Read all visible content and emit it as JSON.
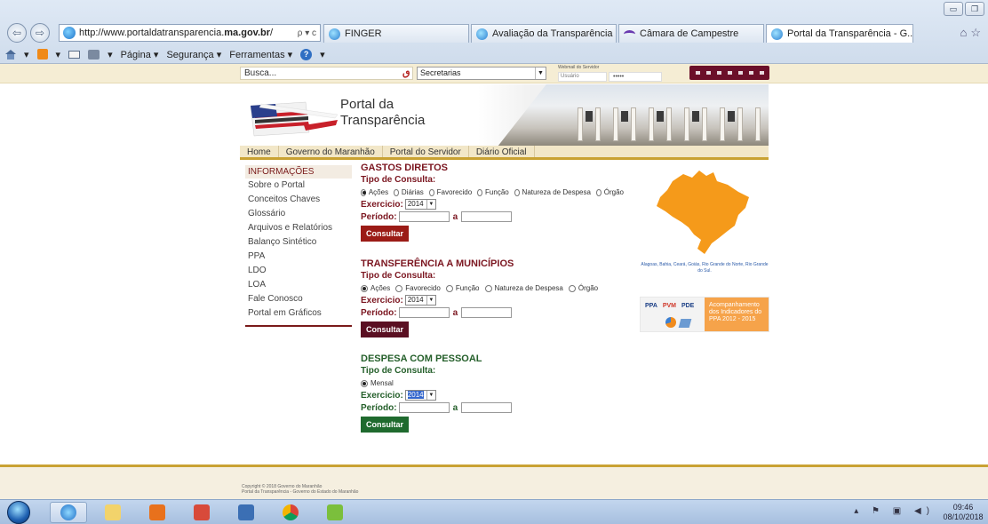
{
  "browser": {
    "url_prefix": "http://www.portaldatransparencia.",
    "url_domain": "ma.gov.br",
    "url_suffix": "/",
    "address_icons": "ρ ▾ c",
    "tabs": [
      {
        "label": "FINGER"
      },
      {
        "label": "Avaliação da Transparência do..."
      },
      {
        "label": "Câmara de Campestre"
      },
      {
        "label": "Portal da Transparência - G..."
      }
    ],
    "command_bar": {
      "page": "Página ▾",
      "security": "Segurança ▾",
      "tools": "Ferramentas ▾"
    }
  },
  "topbar": {
    "search_placeholder": "Busca...",
    "secretarias": "Secretarias",
    "webmail_title": "Webmail do Servidor",
    "webmail_user": "Usuário",
    "webmail_pass": "•••••"
  },
  "header": {
    "title_line1": "Portal da",
    "title_line2": "Transparência"
  },
  "nav": [
    "Home",
    "Governo do Maranhão",
    "Portal do Servidor",
    "Diário Oficial"
  ],
  "sidebar": {
    "heading": "INFORMAÇÕES",
    "items": [
      "Sobre o Portal",
      "Conceitos Chaves",
      "Glossário",
      "Arquivos e Relatórios",
      "Balanço Sintético",
      "PPA",
      "LDO",
      "LOA",
      "Fale Conosco",
      "Portal em Gráficos"
    ]
  },
  "gastos": {
    "title": "GASTOS DIRETOS",
    "tipo": "Tipo de Consulta:",
    "options": [
      "Ações",
      "Diárias",
      "Favorecido",
      "Função",
      "Natureza de Despesa",
      "Órgão"
    ],
    "exercicio_label": "Exercicio:",
    "exercicio_value": "2014",
    "periodo_label": "Período:",
    "a_label": "a",
    "button": "Consultar"
  },
  "transferencia": {
    "title": "TRANSFERÊNCIA A MUNICÍPIOS",
    "tipo": "Tipo de Consulta:",
    "options": [
      "Ações",
      "Favorecido",
      "Função",
      "Natureza de Despesa",
      "Órgão"
    ],
    "exercicio_label": "Exercicio:",
    "exercicio_value": "2014",
    "periodo_label": "Período:",
    "a_label": "a",
    "button": "Consultar"
  },
  "despesa": {
    "title": "DESPESA COM PESSOAL",
    "tipo": "Tipo de Consulta:",
    "options": [
      "Mensal"
    ],
    "exercicio_label": "Exercicio:",
    "exercicio_value": "2014",
    "periodo_label": "Período:",
    "a_label": "a",
    "button": "Consultar"
  },
  "map_caption": "Alagoas, Bahia, Ceará, Goiás, Rio Grande do Norte, Rio Grande do Sul.",
  "ppa_banner": {
    "ppa": "PPA",
    "pvm": "PVM",
    "pde": "PDE",
    "right_line1": "Acompanhamento",
    "right_line2": "dos Indicadores do",
    "right_line3": "PPA 2012 - 2015"
  },
  "footer": {
    "copyright_line1": "Copyright © 2018 Governo do Maranhão",
    "copyright_line2": "Portal da Transparência - Governo do Estado do Maranhão"
  },
  "taskbar": {
    "time": "09:46",
    "date": "08/10/2018"
  },
  "colors": {
    "gastos_button": "#9b1b16",
    "transferencia_button": "#5a0f22",
    "despesa_button": "#1f6a2e",
    "nav_underline": "#c9a233",
    "map_orange": "#f59a1a"
  }
}
